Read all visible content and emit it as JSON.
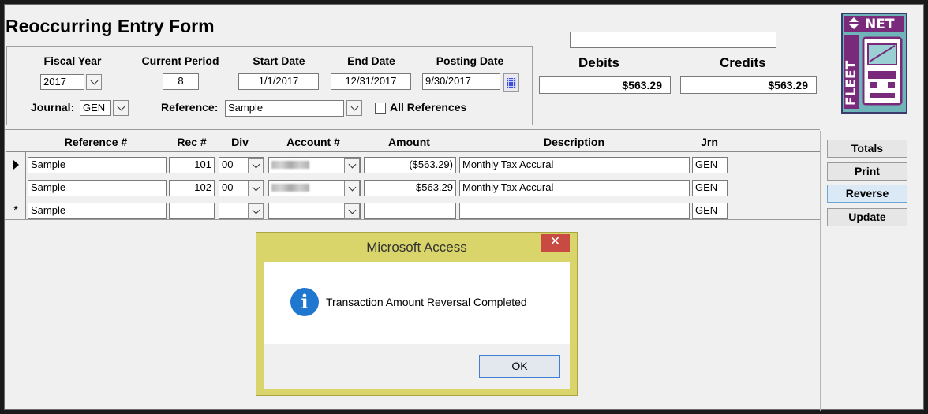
{
  "form": {
    "title": "Reoccurring Entry Form",
    "fiscal_year_label": "Fiscal Year",
    "fiscal_year": "2017",
    "current_period_label": "Current Period",
    "current_period": "8",
    "start_date_label": "Start Date",
    "start_date": "1/1/2017",
    "end_date_label": "End Date",
    "end_date": "12/31/2017",
    "posting_date_label": "Posting Date",
    "posting_date": "9/30/2017",
    "journal_label": "Journal:",
    "journal": "GEN",
    "reference_label": "Reference:",
    "reference": "Sample",
    "all_references_label": "All References",
    "all_references_checked": false
  },
  "totals": {
    "search_value": "",
    "debits_label": "Debits",
    "debits": "$563.29",
    "credits_label": "Credits",
    "credits": "$563.29"
  },
  "logo": {
    "text": "FLEET NET",
    "colors": [
      "#6fb4b8",
      "#7a2a7a",
      "#3b3b6b"
    ]
  },
  "grid": {
    "columns": [
      "Reference #",
      "Rec #",
      "Div",
      "Account #",
      "Amount",
      "Description",
      "Jrn"
    ],
    "rows": [
      {
        "selector": "current",
        "reference": "Sample",
        "rec": "101",
        "div": "00",
        "account": "",
        "amount": "($563.29)",
        "description": "Monthly Tax Accural",
        "jrn": "GEN"
      },
      {
        "selector": "",
        "reference": "Sample",
        "rec": "102",
        "div": "00",
        "account": "",
        "amount": "$563.29",
        "description": "Monthly Tax Accural",
        "jrn": "GEN"
      },
      {
        "selector": "*",
        "reference": "Sample",
        "rec": "",
        "div": "",
        "account": "",
        "amount": "",
        "description": "",
        "jrn": "GEN"
      }
    ]
  },
  "side_buttons": {
    "totals": "Totals",
    "print": "Print",
    "reverse": "Reverse",
    "update": "Update"
  },
  "dialog": {
    "title": "Microsoft Access",
    "close": "✕",
    "icon": "info-icon",
    "message": "Transaction Amount Reversal Completed",
    "ok_label": "OK"
  }
}
